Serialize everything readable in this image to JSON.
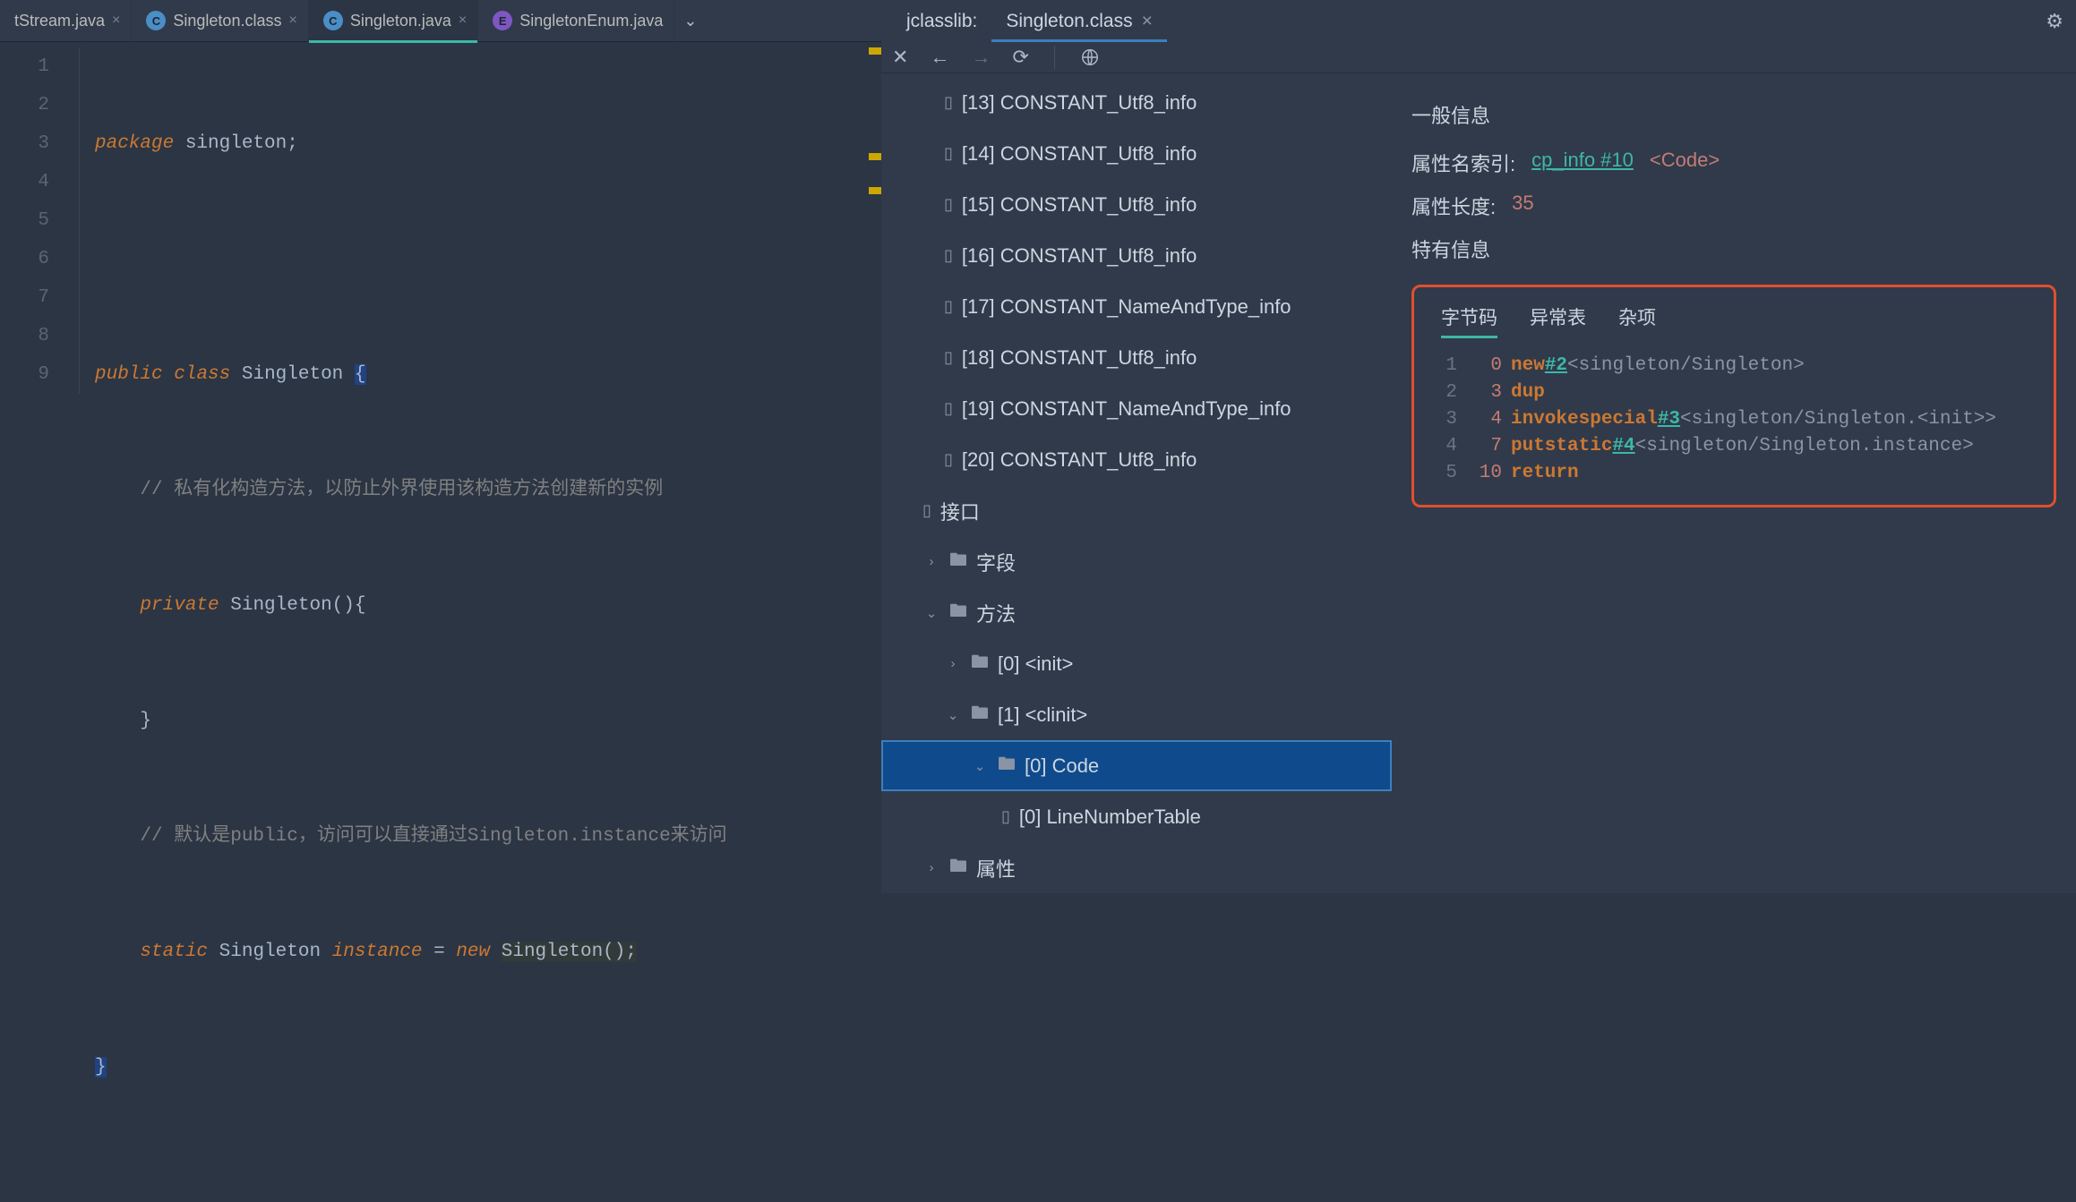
{
  "tabs": {
    "t0": "tStream.java",
    "t1": "Singleton.class",
    "t2": "Singleton.java",
    "t3": "SingletonEnum.java"
  },
  "code": {
    "l1_pkg": "package",
    "l1_name": "singleton",
    "l1_semi": ";",
    "l3_pub": "public",
    "l3_cls": "class",
    "l3_name": "Singleton",
    "l3_brace": "{",
    "l4_cmt": "// 私有化构造方法，以防止外界使用该构造方法创建新的实例",
    "l5_priv": "private",
    "l5_ctor": "Singleton(){",
    "l6_brace": "}",
    "l7_cmt": "// 默认是public，访问可以直接通过Singleton.instance来访问",
    "l8_static": "static",
    "l8_type": "Singleton",
    "l8_var": "instance",
    "l8_eq": " = ",
    "l8_new": "new",
    "l8_call": "Singleton();",
    "l9_brace": "}"
  },
  "linenumbers": [
    "1",
    "2",
    "3",
    "4",
    "5",
    "6",
    "7",
    "8",
    "9"
  ],
  "jclasslib": {
    "title_prefix": "jclasslib:",
    "title_file": "Singleton.class"
  },
  "tree": {
    "cp13": "[13] CONSTANT_Utf8_info",
    "cp14": "[14] CONSTANT_Utf8_info",
    "cp15": "[15] CONSTANT_Utf8_info",
    "cp16": "[16] CONSTANT_Utf8_info",
    "cp17": "[17] CONSTANT_NameAndType_info",
    "cp18": "[18] CONSTANT_Utf8_info",
    "cp19": "[19] CONSTANT_NameAndType_info",
    "cp20": "[20] CONSTANT_Utf8_info",
    "interfaces": "接口",
    "fields": "字段",
    "methods": "方法",
    "m0": "[0] <init>",
    "m1": "[1] <clinit>",
    "code": "[0] Code",
    "lnt": "[0] LineNumberTable",
    "attrs": "属性"
  },
  "detail": {
    "general": "一般信息",
    "attr_name_label": "属性名索引:",
    "attr_name_link": "cp_info #10",
    "attr_name_tag": "<Code>",
    "attr_len_label": "属性长度:",
    "attr_len_val": "35",
    "specific": "特有信息",
    "tab_bytecode": "字节码",
    "tab_exc": "异常表",
    "tab_misc": "杂项"
  },
  "bytecode": [
    {
      "ln": "1",
      "off": "0",
      "instr": "new",
      "ref": "#2",
      "cmt": "<singleton/Singleton>"
    },
    {
      "ln": "2",
      "off": "3",
      "instr": "dup",
      "ref": "",
      "cmt": ""
    },
    {
      "ln": "3",
      "off": "4",
      "instr": "invokespecial",
      "ref": "#3",
      "cmt": "<singleton/Singleton.<init>>"
    },
    {
      "ln": "4",
      "off": "7",
      "instr": "putstatic",
      "ref": "#4",
      "cmt": "<singleton/Singleton.instance>"
    },
    {
      "ln": "5",
      "off": "10",
      "instr": "return",
      "ref": "",
      "cmt": ""
    }
  ]
}
